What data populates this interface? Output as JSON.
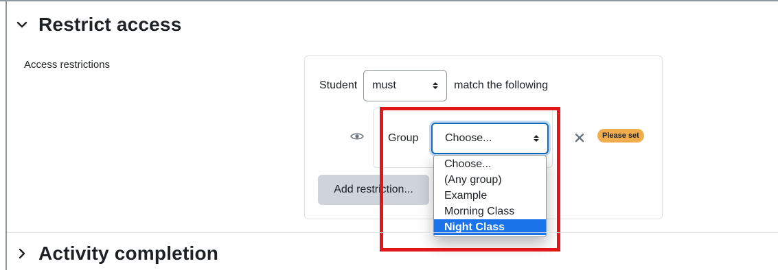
{
  "sections": {
    "restrict": {
      "title": "Restrict access",
      "expanded": true
    },
    "completion": {
      "title": "Activity completion",
      "expanded": false
    }
  },
  "restrictions": {
    "label": "Access restrictions",
    "subject": "Student",
    "mode_value": "must",
    "match_text": "match the following",
    "condition": {
      "type_label": "Group",
      "select_value": "Choose...",
      "badge": "Please set"
    },
    "add_button": "Add restriction...",
    "dropdown_options": [
      "Choose...",
      "(Any group)",
      "Example",
      "Morning Class",
      "Night Class"
    ],
    "highlighted_option": "Night Class"
  },
  "colors": {
    "accent": "#0f6cbf",
    "selection": "#1a73e8",
    "badge": "#f0ad4e",
    "annotation": "#e2151b"
  }
}
